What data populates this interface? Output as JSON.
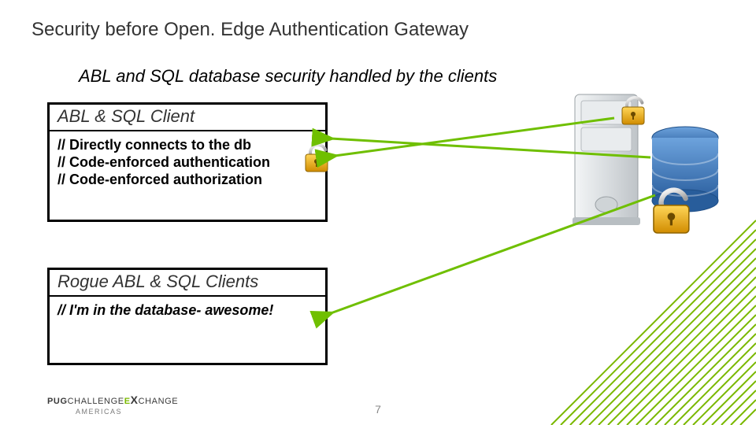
{
  "title": "Security before Open. Edge Authentication Gateway",
  "subtitle": "ABL and SQL database security handled by the clients",
  "boxes": {
    "client": {
      "heading": "ABL & SQL Client",
      "lines": [
        "// Directly connects to the db",
        "// Code-enforced authentication",
        "// Code-enforced authorization"
      ]
    },
    "rogue": {
      "heading": "Rogue ABL & SQL Clients",
      "line": "// I'm in the database- awesome!"
    }
  },
  "footer": {
    "brand_parts": [
      "PUG",
      "CHALLENGE",
      "E",
      "X",
      "CHANGE"
    ],
    "region": "AMERICAS",
    "pagenum": "7"
  },
  "icons": {
    "padlock_open": "padlock-open-icon",
    "server": "server-icon",
    "database": "database-icon"
  },
  "colors": {
    "accent": "#7ab800",
    "arrow": "#6fbf00",
    "padlock_body": "#e6a400",
    "padlock_metal": "#c9c9c9",
    "server_body": "#d9dde0",
    "db_blue": "#3b74b9"
  }
}
